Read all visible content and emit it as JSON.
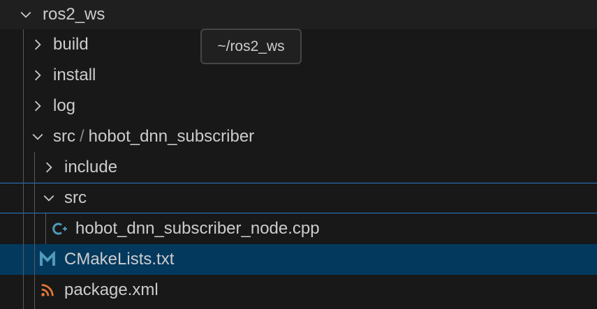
{
  "explorer": {
    "root": {
      "label": "ros2_ws",
      "expanded": true
    },
    "folders": [
      {
        "label": "build",
        "expanded": false
      },
      {
        "label": "install",
        "expanded": false
      },
      {
        "label": "log",
        "expanded": false
      }
    ],
    "compact_folder": {
      "part1": "src",
      "separator": "/",
      "part2": "hobot_dnn_subscriber",
      "expanded": true
    },
    "subfolders": [
      {
        "label": "include",
        "expanded": false
      },
      {
        "label": "src",
        "expanded": true
      }
    ],
    "files": [
      {
        "label": "hobot_dnn_subscriber_node.cpp",
        "icon": "cpp-file-icon"
      },
      {
        "label": "CMakeLists.txt",
        "icon": "cmake-file-icon",
        "selected": true
      },
      {
        "label": "package.xml",
        "icon": "rss-xml-file-icon"
      }
    ]
  },
  "tooltip": {
    "text": "~/ros2_ws"
  },
  "colors": {
    "background": "#181818",
    "selection": "#04395e",
    "focus_border": "#2b79d0",
    "cpp_icon": "#519aba",
    "cmake_icon": "#519aba",
    "xml_icon": "#e37933"
  }
}
